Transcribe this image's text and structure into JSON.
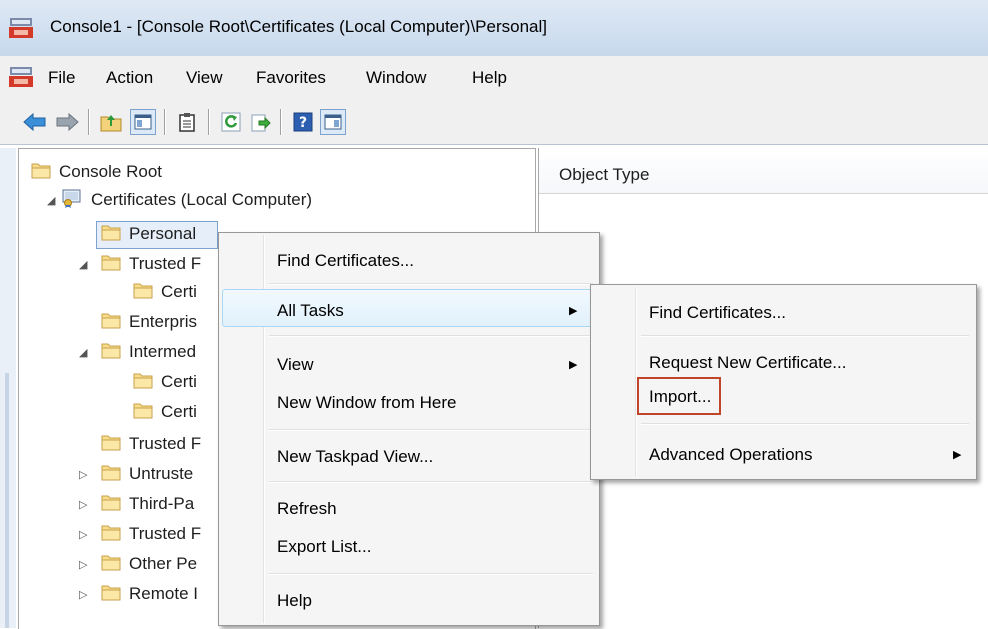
{
  "window": {
    "title": "Console1 - [Console Root\\Certificates (Local Computer)\\Personal]"
  },
  "menubar": {
    "items": [
      "File",
      "Action",
      "View",
      "Favorites",
      "Window",
      "Help"
    ]
  },
  "toolbar": {
    "icons": [
      "back-arrow-icon",
      "forward-arrow-icon",
      "up-folder-icon",
      "show-hide-console-tree-icon",
      "clipboard-icon",
      "refresh-icon",
      "export-list-icon",
      "help-icon",
      "show-hide-action-pane-icon"
    ]
  },
  "tree": {
    "rows": [
      {
        "label": "Console Root",
        "expander": ""
      },
      {
        "label": "Certificates (Local Computer)",
        "expander": "◢"
      },
      {
        "label": "Personal",
        "expander": ""
      },
      {
        "label": "Trusted F",
        "expander": "◢"
      },
      {
        "label": "Certi",
        "expander": ""
      },
      {
        "label": "Enterpris",
        "expander": ""
      },
      {
        "label": "Intermed",
        "expander": "◢"
      },
      {
        "label": "Certi",
        "expander": ""
      },
      {
        "label": "Certi",
        "expander": ""
      },
      {
        "label": "Trusted F",
        "expander": ""
      },
      {
        "label": "Untruste",
        "expander": "▷"
      },
      {
        "label": "Third-Pa",
        "expander": "▷"
      },
      {
        "label": "Trusted F",
        "expander": "▷"
      },
      {
        "label": "Other Pe",
        "expander": "▷"
      },
      {
        "label": "Remote I",
        "expander": "▷"
      }
    ]
  },
  "list": {
    "column_header": "Object Type"
  },
  "context_menu": {
    "items": {
      "find": "Find Certificates...",
      "all_tasks": "All Tasks",
      "view": "View",
      "new_window": "New Window from Here",
      "new_taskpad": "New Taskpad View...",
      "refresh": "Refresh",
      "export_list": "Export List...",
      "help": "Help"
    }
  },
  "submenu": {
    "items": {
      "find": "Find Certificates...",
      "request": "Request New Certificate...",
      "import": "Import...",
      "advanced": "Advanced Operations"
    }
  },
  "colors": {
    "highlight_box": "#c0452a",
    "menu_hover": "#e1f1fc"
  }
}
